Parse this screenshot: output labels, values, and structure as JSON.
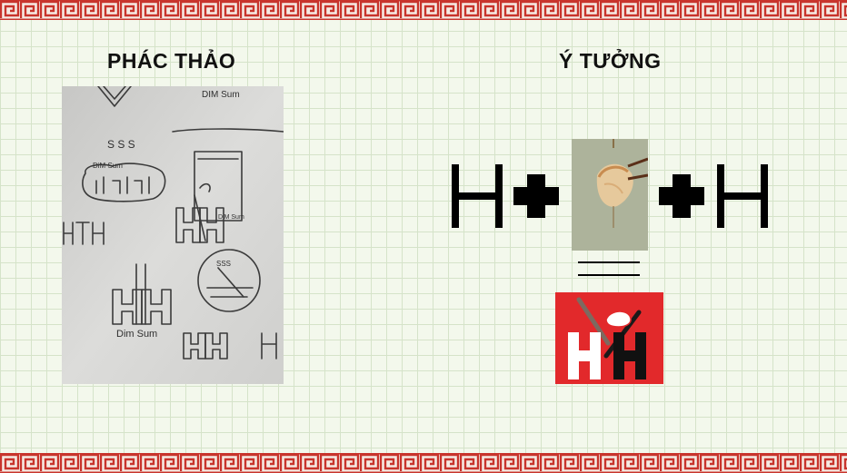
{
  "slide": {
    "left_heading": "PHÁC THẢO",
    "right_heading": "Ý TƯỞNG"
  },
  "sketch": {
    "texts": {
      "dim_sum_1": "DIM Sum",
      "dim_sum_2": "DiM Sum",
      "dim_sum_3": "DiM Sum",
      "dim_sum_4": "Dim Sum",
      "badge": "DIM SUM",
      "ssss_1": "S S S",
      "ssss_2": "SSS",
      "letters": "HTH"
    }
  },
  "colors": {
    "border_red": "#c8342c",
    "logo_red": "#e2292b",
    "grid_line": "#d5e3c9",
    "page_bg": "#f3f8ec"
  },
  "icons": {
    "border": "greek-key-pattern",
    "letter": "letter-h-glyph",
    "plus": "plus-icon",
    "photo": "dumpling-chopsticks-photo",
    "logo": "hh-dim-sum-logo"
  }
}
